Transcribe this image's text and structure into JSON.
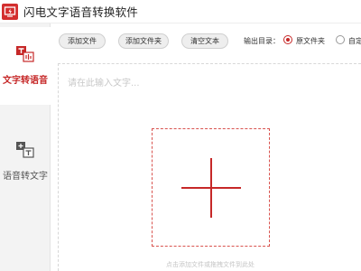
{
  "window": {
    "title": "闪电文字语音转换软件",
    "logo_icon": "lightning-logo-icon"
  },
  "sidebar": {
    "items": [
      {
        "label": "文字转语音",
        "icon": "text-to-speech-icon",
        "active": true
      },
      {
        "label": "语音转文字",
        "icon": "speech-to-text-icon",
        "active": false
      }
    ]
  },
  "toolbar": {
    "add_file": "添加文件",
    "add_folder": "添加文件夹",
    "clear_text": "清空文本",
    "output_label": "输出目录：",
    "output_options": [
      {
        "label": "原文件夹",
        "checked": true
      },
      {
        "label": "自定",
        "checked": false
      }
    ]
  },
  "editor": {
    "placeholder": "请在此输入文字...",
    "add_icon": "plus-icon",
    "drop_hint": "点击添加文件或拖拽文件到此处"
  },
  "colors": {
    "accent": "#c62828",
    "sidebar_bg": "#f3f3f3",
    "button_bg": "#eeeeee"
  }
}
